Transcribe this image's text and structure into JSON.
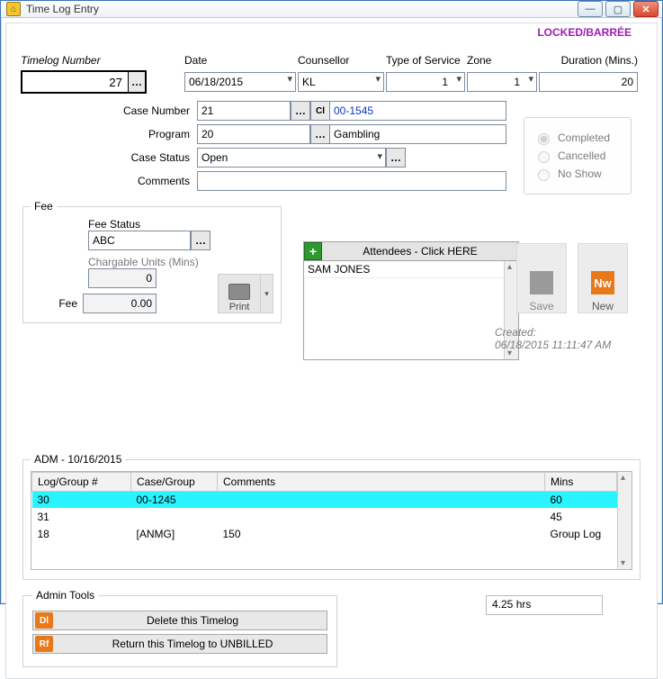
{
  "window": {
    "title": "Time Log Entry"
  },
  "locked": "LOCKED/BARRÉE",
  "labels": {
    "timelog_number": "Timelog Number",
    "date": "Date",
    "counsellor": "Counsellor",
    "type_of_service": "Type of Service",
    "zone": "Zone",
    "duration": "Duration (Mins.)",
    "case_number": "Case Number",
    "program": "Program",
    "case_status": "Case Status",
    "comments": "Comments",
    "cl": "Cl"
  },
  "values": {
    "timelog_number": "27",
    "date": "06/18/2015",
    "counsellor": "KL",
    "type_of_service": "1",
    "zone": "1",
    "duration": "20",
    "case_number": "21",
    "case_number_link": "00-1545",
    "program": "20",
    "program_text": "Gambling",
    "case_status": "Open",
    "comments": ""
  },
  "status_radio": {
    "completed": "Completed",
    "cancelled": "Cancelled",
    "noshow": "No Show",
    "selected": "completed"
  },
  "fee": {
    "legend": "Fee",
    "fee_status_label": "Fee Status",
    "fee_status": "ABC",
    "chargable_label": "Chargable Units (Mins)",
    "chargable": "0",
    "fee_label": "Fee",
    "fee_value": "0.00",
    "print_label": "Print"
  },
  "attendees": {
    "header": "Attendees - Click HERE",
    "items": [
      "SAM JONES"
    ]
  },
  "buttons": {
    "save": "Save",
    "new": "New",
    "new_icon": "Nw"
  },
  "created": {
    "label": "Created:",
    "value": "06/18/2015 11:11:47 AM"
  },
  "adm": {
    "legend": "ADM - 10/16/2015",
    "columns": [
      "Log/Group #",
      "Case/Group",
      "Comments",
      "Mins"
    ],
    "rows": [
      {
        "log": "30",
        "case": "00-1245",
        "comments": "",
        "mins": "60",
        "selected": true
      },
      {
        "log": "31",
        "case": "",
        "comments": "",
        "mins": "45",
        "selected": false
      },
      {
        "log": "18",
        "case": "[ANMG]",
        "comments": "150",
        "mins": "Group Log",
        "selected": false
      }
    ]
  },
  "admin_tools": {
    "legend": "Admin Tools",
    "delete": "Delete this Timelog",
    "delete_badge": "Dl",
    "return": "Return this Timelog to UNBILLED",
    "return_badge": "Rf"
  },
  "hours_total": "4.25 hrs"
}
